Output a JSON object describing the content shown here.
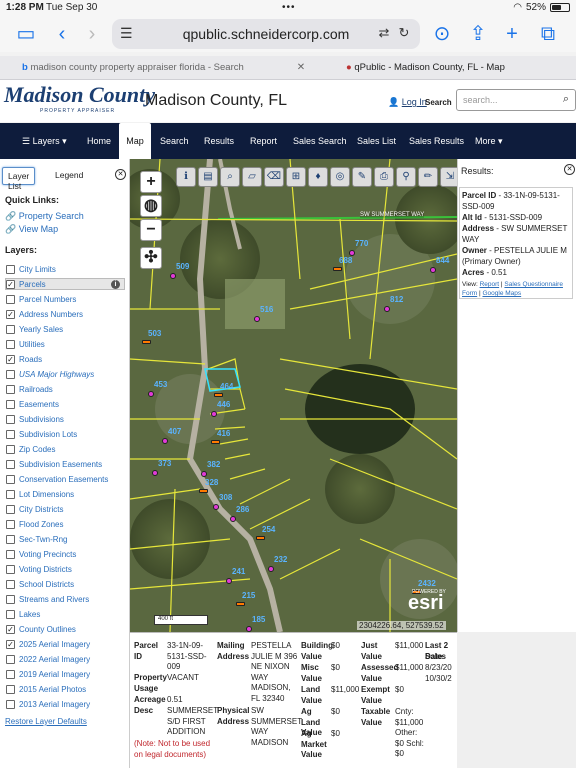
{
  "status_bar": {
    "time": "1:28 PM",
    "date": "Tue Sep 30",
    "dots": "•••",
    "battery": "52%",
    "battery_level": 0.52
  },
  "browser": {
    "url": "qpublic.schneidercorp.com",
    "tabs": [
      {
        "label": "madison county property appraiser florida - Search"
      },
      {
        "label": "qPublic - Madison County, FL - Map"
      }
    ]
  },
  "header": {
    "logo_text": "Madison County",
    "logo_sub": "PROPERTY APPRAISER",
    "county_title": "Madison County, FL",
    "login": "Log In",
    "search_label": "Search",
    "search_placeholder": "search..."
  },
  "nav": {
    "items": [
      "Layers",
      "Home",
      "Map",
      "Search",
      "Results",
      "Report",
      "Sales Search",
      "Sales List",
      "Sales Results",
      "More"
    ]
  },
  "left_panel": {
    "tabs": [
      "Layer List",
      "Legend"
    ],
    "quick_links_title": "Quick Links:",
    "quick_links": [
      "Property Search",
      "View Map"
    ],
    "layers_title": "Layers:",
    "layers": [
      {
        "name": "City Limits",
        "checked": false
      },
      {
        "name": "Parcels",
        "checked": true
      },
      {
        "name": "Parcel Numbers",
        "checked": false
      },
      {
        "name": "Address Numbers",
        "checked": true
      },
      {
        "name": "Yearly Sales",
        "checked": false
      },
      {
        "name": "Utilities",
        "checked": false
      },
      {
        "name": "Roads",
        "checked": true
      },
      {
        "name": "USA Major Highways",
        "checked": false
      },
      {
        "name": "Railroads",
        "checked": false
      },
      {
        "name": "Easements",
        "checked": false
      },
      {
        "name": "Subdivisions",
        "checked": false
      },
      {
        "name": "Subdivision Lots",
        "checked": false
      },
      {
        "name": "Zip Codes",
        "checked": false
      },
      {
        "name": "Subdivision Easements",
        "checked": false
      },
      {
        "name": "Conservation Easements",
        "checked": false
      },
      {
        "name": "Lot Dimensions",
        "checked": false
      },
      {
        "name": "City Districts",
        "checked": false
      },
      {
        "name": "Flood Zones",
        "checked": false
      },
      {
        "name": "Sec-Twn-Rng",
        "checked": false
      },
      {
        "name": "Voting Precincts",
        "checked": false
      },
      {
        "name": "Voting Districts",
        "checked": false
      },
      {
        "name": "School Districts",
        "checked": false
      },
      {
        "name": "Streams and Rivers",
        "checked": false
      },
      {
        "name": "Lakes",
        "checked": false
      },
      {
        "name": "County Outlines",
        "checked": true
      },
      {
        "name": "2025 Aerial Imagery",
        "checked": true
      },
      {
        "name": "2022 Aerial Imagery",
        "checked": false
      },
      {
        "name": "2019 Aerial Imagery",
        "checked": false
      },
      {
        "name": "2015 Aerial Photos",
        "checked": false
      },
      {
        "name": "2013 Aerial Imagery",
        "checked": false
      }
    ],
    "restore": "Restore Layer Defaults"
  },
  "map": {
    "road_label": "SW SUMMERSET WAY",
    "scale": "400 ft",
    "coords": "2304226.64, 527539.52",
    "esri_label": "esri",
    "esri_powered": "POWERED BY",
    "address_labels": [
      "509",
      "503",
      "516",
      "453",
      "464",
      "446",
      "407",
      "416",
      "373",
      "382",
      "328",
      "308",
      "286",
      "254",
      "232",
      "241",
      "215",
      "185",
      "770",
      "688",
      "812",
      "844",
      "2432"
    ]
  },
  "results": {
    "title": "Results:",
    "parcel_id_label": "Parcel ID",
    "parcel_id": "33-1N-09-5131-SSD-009",
    "alt_id_label": "Alt Id",
    "alt_id": "5131-SSD-009",
    "address_label": "Address",
    "address": "SW SUMMERSET WAY",
    "owner_label": "Owner",
    "owner": "PESTELLA JULIE M (Primary Owner)",
    "acres_label": "Acres",
    "acres": "0.51",
    "view_label": "View:",
    "links": [
      "Report",
      "Sales Questionnaire Form",
      "Google Maps"
    ]
  },
  "info": {
    "parcel_id_label": "Parcel ID",
    "parcel_id": "33-1N-09-5131-SSD-009",
    "property_usage_label": "Property Usage",
    "property_usage": "VACANT",
    "acreage_label": "Acreage",
    "acreage": "0.51",
    "desc_label": "Desc",
    "desc": "SUMMERSET S/D FIRST ADDITION",
    "note": "(Note: Not to be used on legal documents)",
    "mailing_label": "Mailing Address",
    "mailing": "PESTELLA JULIE M 396 NE NIXON WAY MADISON, FL 32340",
    "physical_label": "Physical Address",
    "physical": "SW SUMMERSET WAY MADISON",
    "building_label": "Building Value",
    "building": "$0",
    "misc_label": "Misc Value",
    "misc": "$0",
    "land_label": "Land Value",
    "land": "$11,000",
    "agland_label": "Ag Land Value",
    "agland": "$0",
    "agmarket_label": "Ag Market Value",
    "agmarket": "$0",
    "just_label": "Just Value",
    "just": "$11,000",
    "assessed_label": "Assessed Value",
    "assessed": "$11,000",
    "exempt_label": "Exempt Value",
    "exempt": "$0",
    "taxable_label": "Taxable Value",
    "taxable": "Cnty: $11,000 Other: $0 Schl: $0",
    "last_sale_label": "Last 2 Sales",
    "date_label": "Date",
    "dates": "8/23/20 10/30/2"
  }
}
